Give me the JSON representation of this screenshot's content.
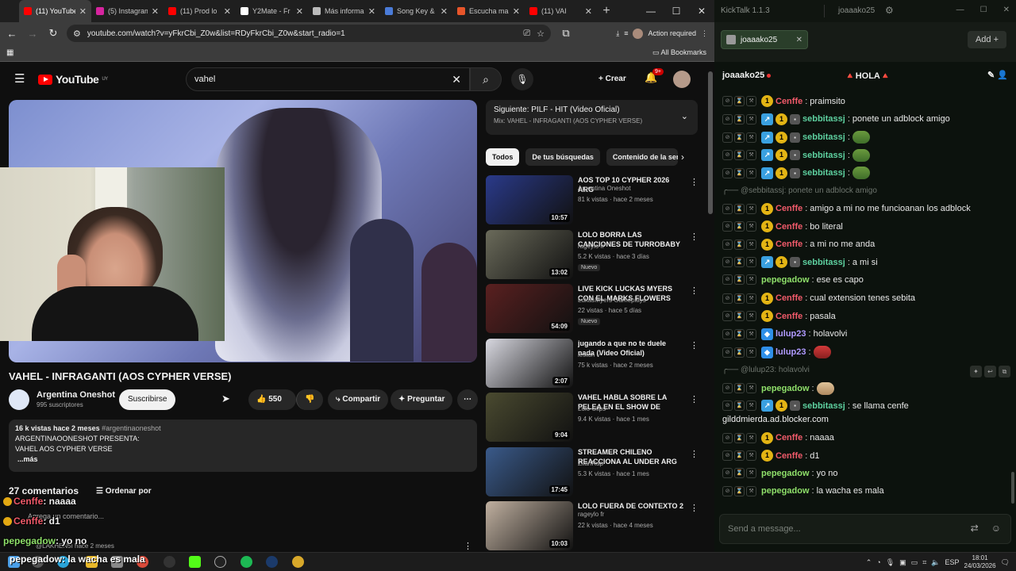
{
  "browser": {
    "tabs": [
      {
        "title": "(11) YouTube",
        "color": "#ff0000"
      },
      {
        "title": "(5) Instagram",
        "color": "#d6249f"
      },
      {
        "title": "(11) Prod lo",
        "color": "#ff0000"
      },
      {
        "title": "Y2Mate - Fr",
        "color": "#ffffff"
      },
      {
        "title": "Más informa",
        "color": "#bbbbbb"
      },
      {
        "title": "Song Key &",
        "color": "#4a7bd8"
      },
      {
        "title": "Escucha ma",
        "color": "#e8552a"
      },
      {
        "title": "(11) VAI",
        "color": "#ff0000"
      }
    ],
    "url": "youtube.com/watch?v=yFkrCbi_Z0w&list=RDyFkrCbi_Z0w&start_radio=1",
    "action_required": "Action required",
    "all_bookmarks": "All Bookmarks"
  },
  "youtube": {
    "logo_text": "YouTube",
    "logo_region": "UY",
    "search_query": "vahel",
    "create_label": "Crear",
    "notification_count": "9+",
    "video_title": "VAHEL - INFRAGANTI (AOS CYPHER VERSE)",
    "channel_name": "Argentina Oneshot",
    "channel_subs": "995 suscriptores",
    "subscribe_label": "Suscribirse",
    "likes": "550",
    "share_label": "Compartir",
    "ask_label": "Preguntar",
    "desc_meta": "16 k vistas  hace 2 meses",
    "desc_tag": "#argentinaoneshot",
    "desc_line1": "ARGENTINAOONESHOT PRESENTA:",
    "desc_line2": "VAHEL AOS CYPHER VERSE",
    "desc_more": "...más",
    "comments_count": "27 comentarios",
    "sort_label": "Ordenar por",
    "add_comment_placeholder": "Agrega un comentario...",
    "comment_user": "@LAKHEN5I  hace 2 meses",
    "next_label": "Siguiente: PILF - HIT (Video Oficial)",
    "next_mix": "Mix: VAHEL - INFRAGANTI (AOS CYPHER VERSE)",
    "chips": [
      "Todos",
      "De tus búsquedas",
      "Contenido de la ser"
    ],
    "videos": [
      {
        "title": "AOS TOP 10 CYPHER 2026 ARG",
        "channel": "Argentina Oneshot",
        "views": "81 k vistas · hace 2 meses",
        "duration": "10:57",
        "badge": "",
        "thumb": "#2a3a8a"
      },
      {
        "title": "LOLO BORRA LAS CANCIONES DE TURROBABY 💀",
        "channel": "rageylo fr",
        "views": "5.2 K vistas · hace 3 días",
        "duration": "13:02",
        "badge": "Nuevo",
        "thumb": "#6a6a5a"
      },
      {
        "title": "LIVE KICK LUCKAS MYERS CON EL MARKS FLOWERS",
        "channel": "LukasMyers Gameplays",
        "views": "22 vistas · hace 5 días",
        "duration": "54:09",
        "badge": "Nuevo",
        "thumb": "#5a2020"
      },
      {
        "title": "jugando a que no te duele nada (Video Oficial)",
        "channel": "leston ✓",
        "views": "75 k vistas · hace 2 meses",
        "duration": "2:07",
        "badge": "",
        "thumb": "#d8d8e0"
      },
      {
        "title": "VAHEL HABLA SOBRE LA PELEA EN EL SHOW DE CERO*",
        "channel": "Lolo Clips",
        "views": "9.4 K vistas · hace 1 mes",
        "duration": "9:04",
        "badge": "",
        "thumb": "#4a4a30"
      },
      {
        "title": "STREAMER CHILENO REACCIONA AL UNDER ARG ...",
        "channel": "ZilanRap",
        "views": "5.3 K vistas · hace 1 mes",
        "duration": "17:45",
        "badge": "",
        "thumb": "#3a5a8a"
      },
      {
        "title": "LOLO FUERA DE CONTEXTO 2",
        "channel": "rageylo fr",
        "views": "22 k vistas · hace 4 meses",
        "duration": "10:03",
        "badge": "",
        "thumb": "#c0b0a0"
      }
    ]
  },
  "overlay_chat": [
    {
      "user": "Cenffe",
      "text": ": naaaa"
    },
    {
      "user": "Cenffe",
      "text": ": d1"
    },
    {
      "user": "pepegadow",
      "text": ": yo no"
    }
  ],
  "taskbar_overlay": "pepegadow: la wacha es mala",
  "kicktalk": {
    "app_title": "KickTalk 1.1.3",
    "username": "joaaako25",
    "tab_label": "joaaako25",
    "add_label": "Add +",
    "channel": "joaaako25",
    "stream_title": "🔺HOLA🔺",
    "input_placeholder": "Send a message...",
    "messages": [
      {
        "kind": "msg",
        "user": "Cenffe",
        "cls": "u-cen",
        "badges": [
          "num"
        ],
        "text": "praimsito"
      },
      {
        "kind": "msg",
        "user": "sebbitassj",
        "cls": "u-seb",
        "badges": [
          "gift",
          "num",
          "box"
        ],
        "text": "ponete un adblock amigo"
      },
      {
        "kind": "msg",
        "user": "sebbitassj",
        "cls": "u-seb",
        "badges": [
          "gift",
          "num",
          "box"
        ],
        "text": "",
        "emote": "frog"
      },
      {
        "kind": "msg",
        "user": "sebbitassj",
        "cls": "u-seb",
        "badges": [
          "gift",
          "num",
          "box"
        ],
        "text": "",
        "emote": "frog"
      },
      {
        "kind": "msg",
        "user": "sebbitassj",
        "cls": "u-seb",
        "badges": [
          "gift",
          "num",
          "box"
        ],
        "text": "",
        "emote": "frog"
      },
      {
        "kind": "reply",
        "text": "╭── @sebbitassj: ponete un adblock amigo"
      },
      {
        "kind": "msg",
        "user": "Cenffe",
        "cls": "u-cen",
        "badges": [
          "num"
        ],
        "text": "amigo a mi no me funcioanan los adblock"
      },
      {
        "kind": "msg",
        "user": "Cenffe",
        "cls": "u-cen",
        "badges": [
          "num"
        ],
        "text": "bo literal"
      },
      {
        "kind": "msg",
        "user": "Cenffe",
        "cls": "u-cen",
        "badges": [
          "num"
        ],
        "text": "a mi no me anda"
      },
      {
        "kind": "msg",
        "user": "sebbitassj",
        "cls": "u-seb",
        "badges": [
          "gift",
          "num",
          "box"
        ],
        "text": "a mi si"
      },
      {
        "kind": "msg",
        "user": "pepegadow",
        "cls": "u-pep",
        "badges": [],
        "text": "ese es capo"
      },
      {
        "kind": "msg",
        "user": "Cenffe",
        "cls": "u-cen",
        "badges": [
          "num"
        ],
        "text": "cual extension tenes sebita"
      },
      {
        "kind": "msg",
        "user": "Cenffe",
        "cls": "u-cen",
        "badges": [
          "num"
        ],
        "text": "pasala"
      },
      {
        "kind": "msg",
        "user": "lulup23",
        "cls": "u-lul",
        "badges": [
          "cube"
        ],
        "text": "holavolvi"
      },
      {
        "kind": "msg",
        "user": "lulup23",
        "cls": "u-lul",
        "badges": [
          "cube"
        ],
        "text": "",
        "emote": "red"
      },
      {
        "kind": "reply",
        "text": "╭── @lulup23: holavolvi"
      },
      {
        "kind": "msg",
        "user": "pepegadow",
        "cls": "u-pep",
        "badges": [],
        "text": "",
        "emote": "cat"
      },
      {
        "kind": "msg",
        "user": "sebbitassj",
        "cls": "u-seb",
        "badges": [
          "gift",
          "num",
          "box"
        ],
        "text": "se llama cenfe"
      },
      {
        "kind": "wrap",
        "text": "gilddmierda.ad.blocker.com"
      },
      {
        "kind": "msg",
        "user": "Cenffe",
        "cls": "u-cen",
        "badges": [
          "num"
        ],
        "text": "naaaa"
      },
      {
        "kind": "msg",
        "user": "Cenffe",
        "cls": "u-cen",
        "badges": [
          "num"
        ],
        "text": "d1"
      },
      {
        "kind": "msg",
        "user": "pepegadow",
        "cls": "u-pep",
        "badges": [],
        "text": "yo no"
      },
      {
        "kind": "msg",
        "user": "pepegadow",
        "cls": "u-pep",
        "badges": [],
        "text": "la wacha es mala"
      }
    ]
  },
  "system": {
    "language": "ESP",
    "time": "18:01",
    "date": "24/03/2026"
  }
}
